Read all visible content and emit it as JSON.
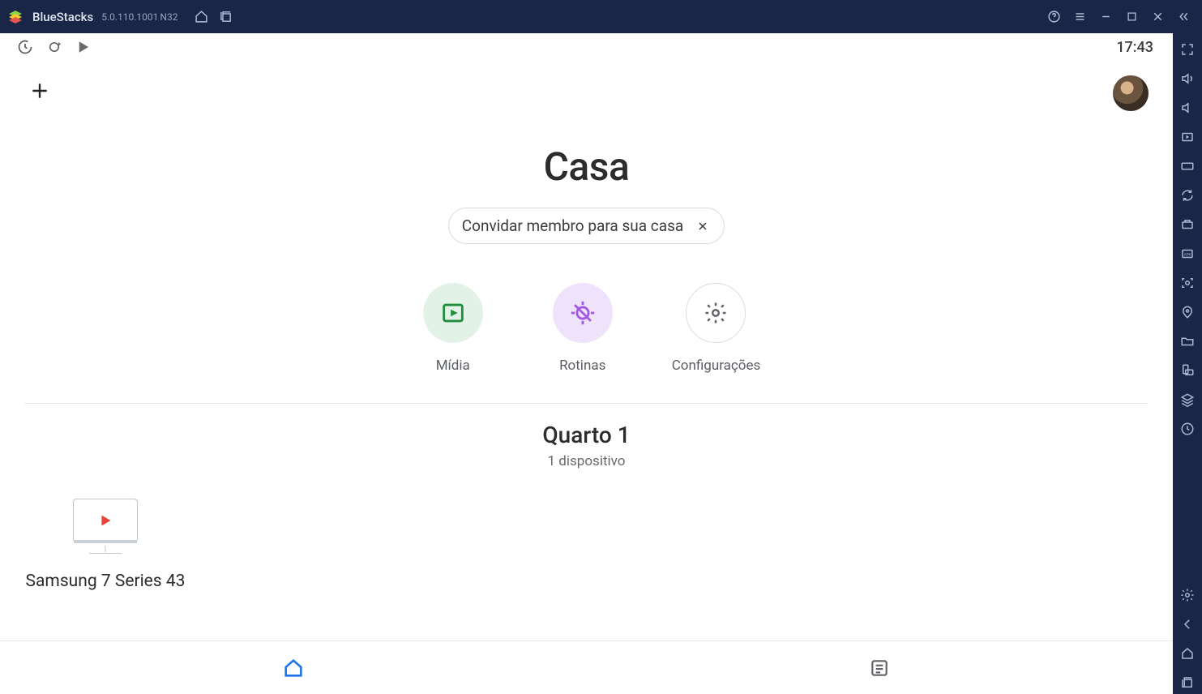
{
  "title_bar": {
    "app_name": "BlueStacks",
    "version": "5.0.110.1001",
    "version_suffix": "N32"
  },
  "status": {
    "clock": "17:43"
  },
  "home": {
    "title": "Casa",
    "invite_chip": "Convidar membro para sua casa",
    "quick": {
      "media": "Mídia",
      "routines": "Rotinas",
      "settings": "Configurações"
    },
    "room": {
      "title": "Quarto 1",
      "subtitle": "1 dispositivo"
    },
    "devices": [
      {
        "name": "Samsung 7 Series 43"
      }
    ]
  }
}
